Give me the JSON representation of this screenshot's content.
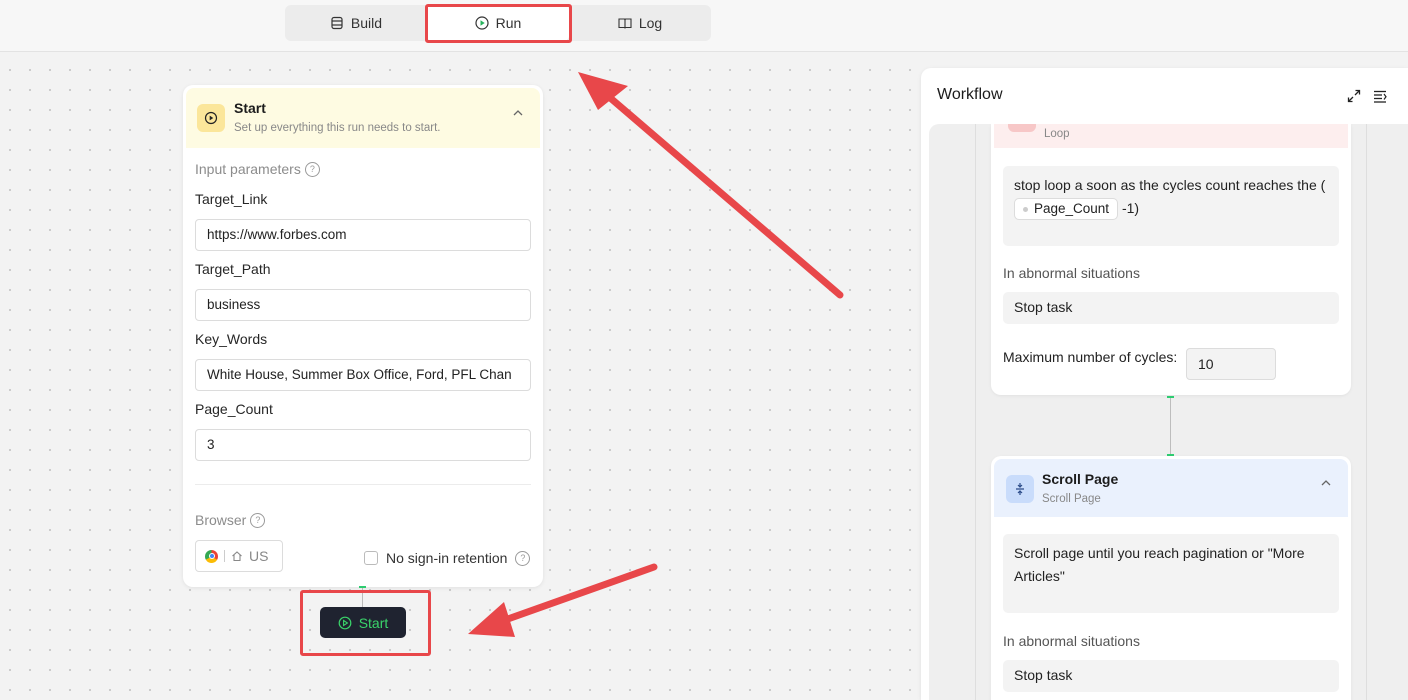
{
  "tabs": {
    "build": "Build",
    "run": "Run",
    "log": "Log"
  },
  "start_panel": {
    "title": "Start",
    "subtitle": "Set up everything this run needs to start.",
    "input_parameters_label": "Input parameters",
    "params": [
      {
        "label": "Target_Link",
        "value": "https://www.forbes.com"
      },
      {
        "label": "Target_Path",
        "value": "business"
      },
      {
        "label": "Key_Words",
        "value": "White House, Summer Box Office, Ford, PFL Chan"
      },
      {
        "label": "Page_Count",
        "value": "3"
      }
    ],
    "browser_label": "Browser",
    "browser_region": "US",
    "no_signin_label": "No sign-in retention",
    "start_button": "Start"
  },
  "workflow": {
    "title": "Workflow",
    "loop_card": {
      "label": "Loop",
      "condition_prefix": "stop loop a soon as the cycles count reaches the (",
      "condition_chip": "Page_Count",
      "condition_suffix": "-1)",
      "abnormal_label": "In abnormal situations",
      "abnormal_value": "Stop task",
      "max_cycles_label": "Maximum number of cycles:",
      "max_cycles_value": "10"
    },
    "scroll_card": {
      "title": "Scroll Page",
      "subtitle": "Scroll Page",
      "description": "Scroll page until you reach pagination or \"More Articles\"",
      "abnormal_label": "In abnormal situations",
      "abnormal_value": "Stop task"
    }
  },
  "colors": {
    "annotation_red": "#e8474a",
    "start_button_bg": "#1f2330",
    "start_button_text": "#3ad46a"
  }
}
